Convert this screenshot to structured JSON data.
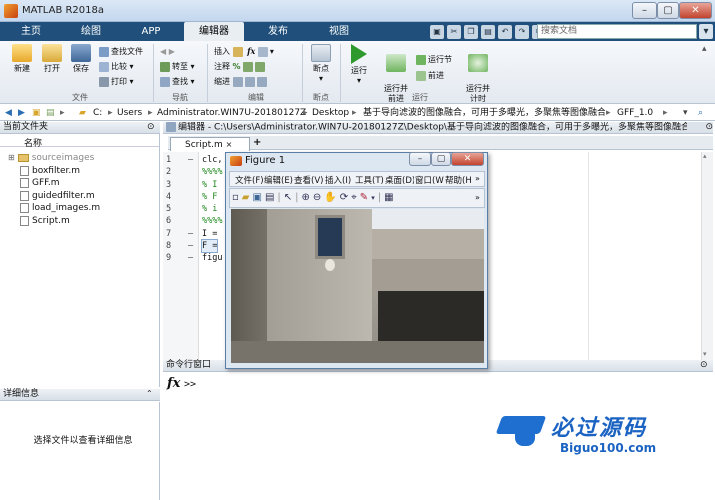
{
  "window": {
    "title": "MATLAB R2018a"
  },
  "tabs": [
    {
      "label": "主页"
    },
    {
      "label": "绘图"
    },
    {
      "label": "APP"
    },
    {
      "label": "编辑器"
    },
    {
      "label": "发布"
    },
    {
      "label": "视图"
    }
  ],
  "search": {
    "placeholder": "搜索文档"
  },
  "ribbon": {
    "file": {
      "new": "新建",
      "open": "打开",
      "save": "保存",
      "find_files": "查找文件",
      "compare": "比较",
      "print": "打印",
      "group": "文件"
    },
    "nav": {
      "goto": "转至",
      "find": "查找",
      "group": "导航"
    },
    "edit": {
      "insert": "插入",
      "comment": "注释",
      "indent": "缩进",
      "fx": "fx",
      "group": "编辑"
    },
    "breakpoints": {
      "label": "断点",
      "group": "断点"
    },
    "run": {
      "run": "运行",
      "run_advance": "运行并\n前进",
      "run_section": "运行节",
      "advance": "前进",
      "run_time": "运行并\n计时",
      "group": "运行"
    }
  },
  "address": {
    "parts": [
      "C:",
      "Users",
      "Administrator.WIN7U-20180127Z",
      "Desktop",
      "基于导向滤波的图像融合，可用于多曝光，多聚焦等图像融合",
      "GFF_1.0"
    ]
  },
  "current_folder": {
    "title": "当前文件夹",
    "column": "名称",
    "items": [
      {
        "name": "sourceimages",
        "type": "folder"
      },
      {
        "name": "boxfilter.m",
        "type": "file"
      },
      {
        "name": "GFF.m",
        "type": "file"
      },
      {
        "name": "guidedfilter.m",
        "type": "file"
      },
      {
        "name": "load_images.m",
        "type": "file"
      },
      {
        "name": "Script.m",
        "type": "file"
      }
    ]
  },
  "details": {
    "title": "详细信息",
    "hint": "选择文件以查看详细信息"
  },
  "editor": {
    "title": "编辑器 - C:\\Users\\Administrator.WIN7U-20180127Z\\Desktop\\基于导向滤波的图像融合，可用于多曝光，多聚焦等图像融合",
    "tab": "Script.m",
    "lines": [
      {
        "n": "1",
        "mark": "–",
        "text": "clc,"
      },
      {
        "n": "2",
        "mark": "",
        "text": "%%%%"
      },
      {
        "n": "3",
        "mark": "",
        "text": "% I"
      },
      {
        "n": "4",
        "mark": "",
        "text": "% F"
      },
      {
        "n": "5",
        "mark": "",
        "text": "% i"
      },
      {
        "n": "6",
        "mark": "",
        "text": "%%%%"
      },
      {
        "n": "7",
        "mark": "–",
        "text": "I ="
      },
      {
        "n": "8",
        "mark": "–",
        "text": "F ="
      },
      {
        "n": "9",
        "mark": "–",
        "text": "figu"
      }
    ]
  },
  "figure": {
    "title": "Figure 1",
    "menu": [
      "文件(F)",
      "编辑(E)",
      "查看(V)",
      "插入(I)",
      "工具(T)",
      "桌面(D)",
      "窗口(W)",
      "帮助(H)"
    ]
  },
  "command": {
    "title": "命令行窗口",
    "prompt": ">>"
  },
  "watermark": {
    "brand": "必过源码",
    "url": "Biguo100.com"
  }
}
